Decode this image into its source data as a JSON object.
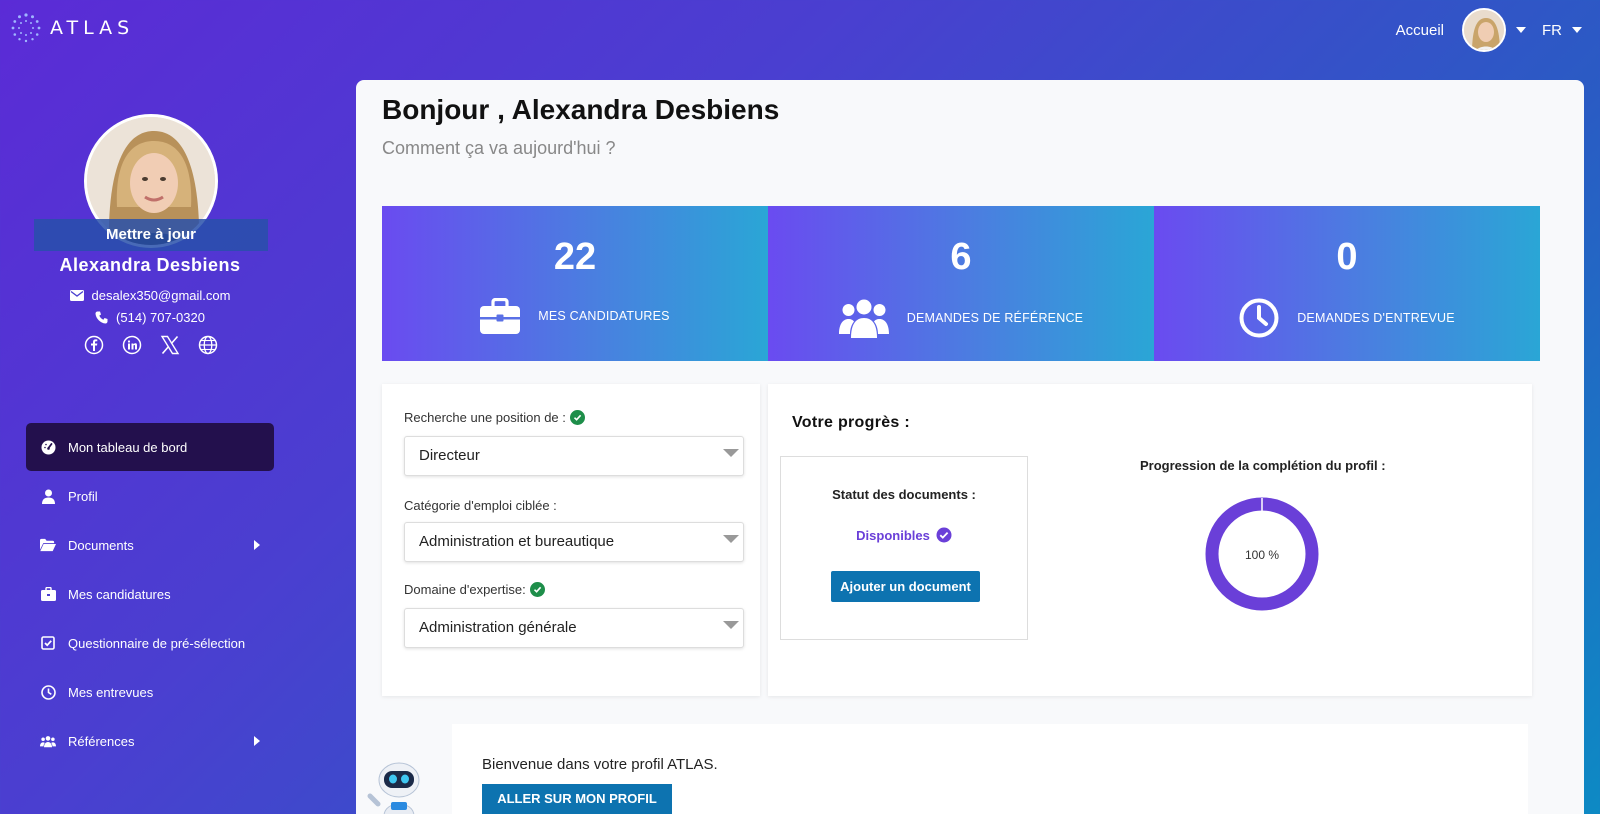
{
  "app": {
    "logo_text": "ATLAS"
  },
  "topnav": {
    "home_label": "Accueil",
    "language": "FR"
  },
  "profile": {
    "update_label": "Mettre à jour",
    "name": "Alexandra  Desbiens",
    "email": "desalex350@gmail.com",
    "phone": "(514) 707-0320",
    "socials": [
      "facebook-icon",
      "linkedin-icon",
      "x-icon",
      "globe-icon"
    ]
  },
  "sidebar": {
    "items": [
      {
        "label": "Mon tableau de bord",
        "icon": "dashboard-icon",
        "active": true
      },
      {
        "label": "Profil",
        "icon": "user-icon"
      },
      {
        "label": "Documents",
        "icon": "folder-icon",
        "submenu": true
      },
      {
        "label": "Mes candidatures",
        "icon": "briefcase-icon"
      },
      {
        "label": "Questionnaire de pré-sélection",
        "icon": "checkbox-icon"
      },
      {
        "label": "Mes entrevues",
        "icon": "clock-icon"
      },
      {
        "label": "Références",
        "icon": "users-icon",
        "submenu": true
      }
    ]
  },
  "main": {
    "greeting": "Bonjour , Alexandra Desbiens",
    "sub_greeting": "Comment ça va aujourd'hui ?",
    "stats": [
      {
        "value": "22",
        "label": "MES CANDIDATURES",
        "icon": "briefcase-icon"
      },
      {
        "value": "6",
        "label": "DEMANDES DE RÉFÉRENCE",
        "icon": "users-icon"
      },
      {
        "value": "0",
        "label": "DEMANDES D'ENTREVUE",
        "icon": "clock-icon"
      }
    ],
    "search": {
      "position_label": "Recherche une position de :",
      "position_value": "Directeur",
      "category_label": "Catégorie d'emploi ciblée :",
      "category_value": "Administration et bureautique",
      "domain_label": "Domaine d'expertise:",
      "domain_value": "Administration générale"
    },
    "progress": {
      "title": "Votre progrès :",
      "doc_status_title": "Statut des documents :",
      "doc_status": "Disponibles",
      "add_doc_label": "Ajouter un document",
      "completion_title": "Progression de la complétion du profil :",
      "completion_percent": 100,
      "completion_text": "100 %"
    },
    "welcome": {
      "text": "Bienvenue dans votre profil ATLAS.",
      "button_label": "ALLER SUR MON PROFIL"
    }
  },
  "colors": {
    "stat_gradient_start": "#6a4bf0",
    "stat_gradient_end": "#2aa6d6",
    "sidebar_active": "#23104d",
    "primary_button": "#0d73b0",
    "donut": "#6a3fd8",
    "check_green": "#1e8e4a"
  }
}
